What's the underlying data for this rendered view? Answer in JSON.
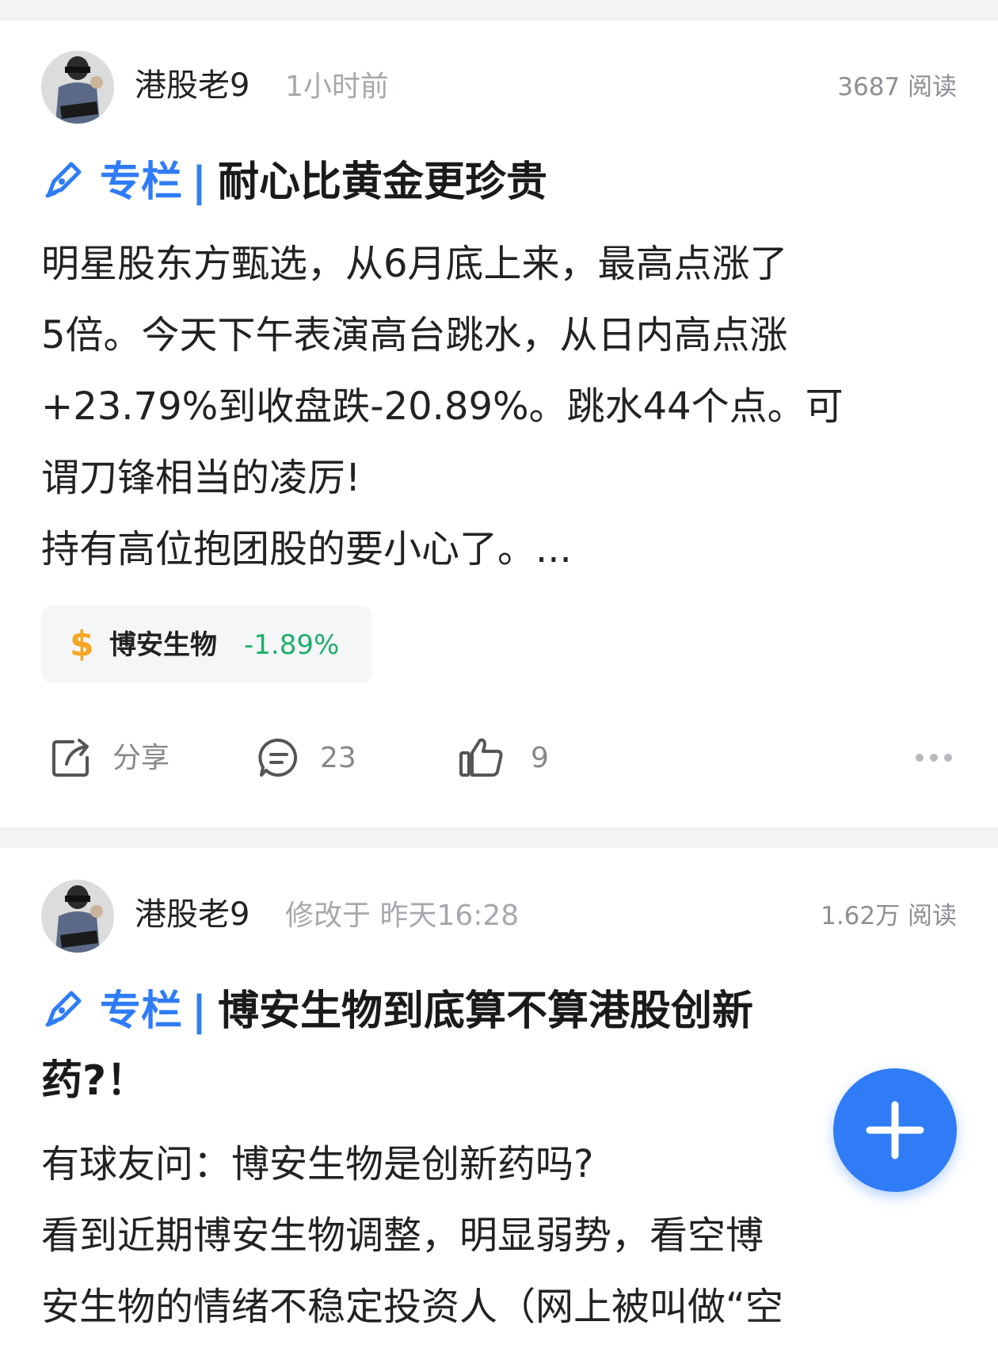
{
  "posts": [
    {
      "author": "港股老9",
      "time": "1小时前",
      "reads": "3687 阅读",
      "title_column": "专栏",
      "title_separator": "|",
      "title": "耐心比黄金更珍贵",
      "body": "明星股东方甄选，从6月底上来，最高点涨了\n5倍。今天下午表演高台跳水，从日内高点涨\n+23.79%到收盘跌-20.89%。跳水44个点。可\n谓刀锋相当的凌厉!\n持有高位抱团股的要小心了。...",
      "stock": {
        "symbol": "$",
        "name": "博安生物",
        "change": "-1.89%",
        "change_color": "#1fae6a"
      },
      "actions": {
        "share": "分享",
        "comments": "23",
        "likes": "9"
      }
    },
    {
      "author": "港股老9",
      "time": "修改于 昨天16:28",
      "reads": "1.62万 阅读",
      "title_column": "专栏",
      "title_separator": "|",
      "title": "博安生物到底算不算港股创新药?！",
      "body": "有球友问：博安生物是创新药吗?\n看到近期博安生物调整，明显弱势，看空博\n安生物的情绪不稳定投资人（网上被叫做“空"
    }
  ],
  "colors": {
    "accent": "#2f7cf6",
    "background": "#f2f3f5",
    "card": "#ffffff"
  },
  "icons": [
    "avatar",
    "pen-icon",
    "dollar-icon",
    "share-icon",
    "comment-icon",
    "like-icon",
    "more-icon",
    "plus-icon"
  ]
}
